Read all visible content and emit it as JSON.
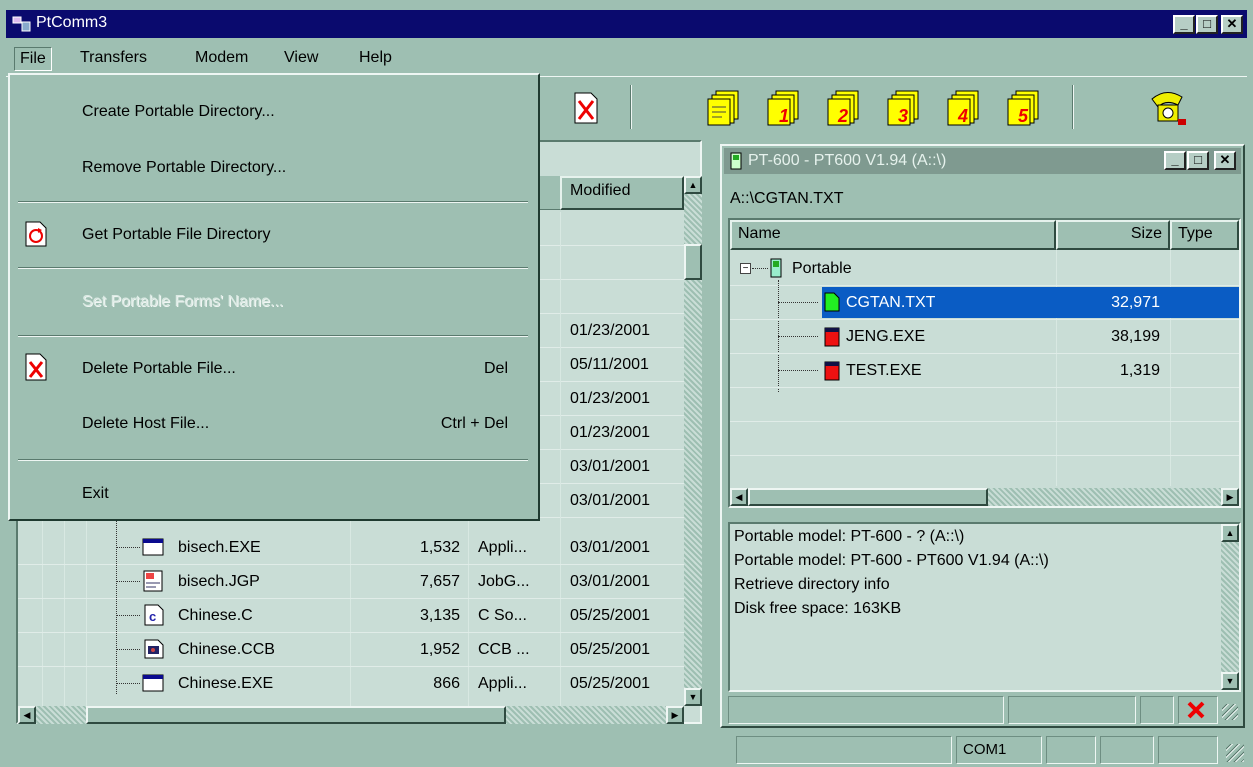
{
  "window": {
    "title": "PtComm3"
  },
  "menubar": {
    "items": [
      "File",
      "Transfers",
      "Modem",
      "View",
      "Help"
    ]
  },
  "file_menu": {
    "items": [
      {
        "label": "Create Portable Directory...",
        "shortcut": "",
        "enabled": true
      },
      {
        "label": "Remove Portable Directory...",
        "shortcut": "",
        "enabled": true
      },
      {
        "label": "Get Portable File Directory",
        "shortcut": "",
        "enabled": true
      },
      {
        "label": "Set Portable Forms' Name...",
        "shortcut": "",
        "enabled": false
      },
      {
        "label": "Delete Portable File...",
        "shortcut": "Del",
        "enabled": true
      },
      {
        "label": "Delete Host File...",
        "shortcut": "Ctrl + Del",
        "enabled": true
      },
      {
        "label": "Exit",
        "shortcut": "",
        "enabled": true
      }
    ]
  },
  "toolbar": {
    "form_buttons": [
      "1",
      "2",
      "3",
      "4",
      "5"
    ]
  },
  "host_pane": {
    "header_modified": "Modified",
    "upper_dates": [
      "01/23/2001",
      "05/11/2001",
      "01/23/2001",
      "01/23/2001",
      "03/01/2001",
      "03/01/2001"
    ],
    "rows": [
      {
        "name": "bisech.EXE",
        "size": "1,532",
        "type": "Appli...",
        "modified": "03/01/2001",
        "icon": "app-icon"
      },
      {
        "name": "bisech.JGP",
        "size": "7,657",
        "type": "JobG...",
        "modified": "03/01/2001",
        "icon": "jobgen-icon"
      },
      {
        "name": "Chinese.C",
        "size": "3,135",
        "type": "C So...",
        "modified": "05/25/2001",
        "icon": "c-source-icon"
      },
      {
        "name": "Chinese.CCB",
        "size": "1,952",
        "type": "CCB ...",
        "modified": "05/25/2001",
        "icon": "ccb-icon"
      },
      {
        "name": "Chinese.EXE",
        "size": "866",
        "type": "Appli...",
        "modified": "05/25/2001",
        "icon": "app-icon"
      }
    ]
  },
  "portable_window": {
    "title": "PT-600 - PT600 V1.94 (A::\\)",
    "path": "A::\\CGTAN.TXT",
    "columns": {
      "name": "Name",
      "size": "Size",
      "type": "Type"
    },
    "root": "Portable",
    "files": [
      {
        "name": "CGTAN.TXT",
        "size": "32,971",
        "selected": true
      },
      {
        "name": "JENG.EXE",
        "size": "38,199",
        "selected": false
      },
      {
        "name": "TEST.EXE",
        "size": "1,319",
        "selected": false
      }
    ],
    "log": [
      "Portable model: PT-600 - ? (A::\\)",
      "Portable model: PT-600 - PT600 V1.94 (A::\\)",
      "Retrieve directory info",
      "Disk free space: 163KB"
    ]
  },
  "statusbar": {
    "port": "COM1"
  },
  "colors": {
    "title_bg": "#0a0a6e",
    "face": "#9ebfb2",
    "grid": "#c9ddd6",
    "selection": "#0a5cc4"
  }
}
